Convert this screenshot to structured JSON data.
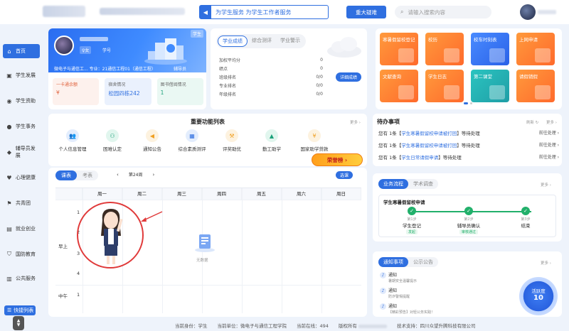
{
  "header": {
    "slogan": "为学生服务 为学生工作者服务",
    "major_button": "重大疑难",
    "search_placeholder": "请输入搜索内容"
  },
  "sidebar": {
    "items": [
      {
        "label": "首页",
        "icon": "home-icon"
      },
      {
        "label": "学生发展",
        "icon": "bag-icon"
      },
      {
        "label": "学生资助",
        "icon": "coin-icon"
      },
      {
        "label": "学生事务",
        "icon": "person-icon"
      },
      {
        "label": "辅导员发展",
        "icon": "graduate-icon"
      },
      {
        "label": "心理健康",
        "icon": "heart-icon"
      },
      {
        "label": "共青团",
        "icon": "flag-icon"
      },
      {
        "label": "就业创业",
        "icon": "briefcase-icon"
      },
      {
        "label": "国防教育",
        "icon": "shield-icon"
      },
      {
        "label": "公共服务",
        "icon": "building-icon"
      }
    ],
    "bottom_label": "快捷列表"
  },
  "profile": {
    "tag": "学生",
    "sex": "♀女",
    "sno_label": "学号",
    "info": "微电子与通信工...  专业：21通信工程01（通信工程）",
    "counselor": "辅导员",
    "mini": [
      {
        "title": "一卡通余额",
        "value": "¥"
      },
      {
        "title": "宿舍情况",
        "value": "松园四栋242"
      },
      {
        "title": "图书借阅情况",
        "value": "1"
      }
    ]
  },
  "grades": {
    "tabs": [
      "学业成绩",
      "综合测评",
      "学业警示"
    ],
    "rows": [
      {
        "label": "加权平均分",
        "value": "0"
      },
      {
        "label": "绩点",
        "value": "0"
      },
      {
        "label": "班级排名",
        "value": "0/0"
      },
      {
        "label": "专业排名",
        "value": "0/0"
      },
      {
        "label": "年级排名",
        "value": "0/0"
      }
    ],
    "detail_button": "详细成绩"
  },
  "quick_tiles": [
    {
      "label": "寒暑假留校登记",
      "color": "orange"
    },
    {
      "label": "校历",
      "color": "orange"
    },
    {
      "label": "校车时刻表",
      "color": "blue"
    },
    {
      "label": "上网申请",
      "color": "orange"
    },
    {
      "label": "文献查询",
      "color": "orange"
    },
    {
      "label": "学生日志",
      "color": "orange"
    },
    {
      "label": "第二课堂",
      "color": "teal"
    },
    {
      "label": "请假销假",
      "color": "orange"
    }
  ],
  "functions": {
    "title": "重要功能列表",
    "more": "更多 ›",
    "items": [
      {
        "label": "个人信息管理",
        "icon": "users-icon",
        "color": "#2f6fe0",
        "bg": "#e3edfd"
      },
      {
        "label": "困难认定",
        "icon": "people-icon",
        "color": "#1aa17a",
        "bg": "#e1f6ee"
      },
      {
        "label": "通知公告",
        "icon": "megaphone-icon",
        "color": "#f0a023",
        "bg": "#fdf2df"
      },
      {
        "label": "综合素质测评",
        "icon": "excel-icon",
        "color": "#2f6fe0",
        "bg": "#e3edfd"
      },
      {
        "label": "评奖助优",
        "icon": "gavel-icon",
        "color": "#f0a023",
        "bg": "#fdf2df"
      },
      {
        "label": "勤工助学",
        "icon": "cap-icon",
        "color": "#1aa17a",
        "bg": "#e1f6ee"
      },
      {
        "label": "国家助学贷款",
        "icon": "money-icon",
        "color": "#f0a023",
        "bg": "#fdf2df"
      }
    ],
    "promo": "荣誉榜 ›"
  },
  "todo": {
    "title": "待办事项",
    "refresh": "刷新 ↻",
    "more": "更多 ›",
    "items": [
      {
        "pre": "您有 1条【",
        "hl": "学生寒暑假留校申请被打回",
        "post": "】等待处理",
        "action": "前往处理 ›"
      },
      {
        "pre": "您有 1条【",
        "hl": "学生寒暑假留校申请被打回",
        "post": "】等待处理",
        "action": "前往处理 ›"
      },
      {
        "pre": "您有 1条【",
        "hl": "学生日常请假申请",
        "post": "】等待处理",
        "action": "前往处理 ›"
      }
    ]
  },
  "timetable": {
    "tabs": [
      "课表",
      "考表"
    ],
    "week": "第24周",
    "select_button": "选课",
    "days": [
      "周一",
      "周二",
      "周三",
      "周四",
      "周五",
      "周六",
      "周日"
    ],
    "sections": {
      "morning": "早上",
      "noon": "中午"
    },
    "periods": [
      "1",
      "2",
      "3",
      "4",
      "1"
    ],
    "empty": "无数据"
  },
  "flow": {
    "tabs": [
      "业务流程",
      "学术调查"
    ],
    "more": "更多 ›",
    "name": "学生寒暑假留校申请",
    "steps": [
      {
        "order": "第1步",
        "name": "学生登记",
        "status": "发起"
      },
      {
        "order": "第2步",
        "name": "辅导员确认",
        "status": "审核通过"
      },
      {
        "order": "第3步",
        "name": "结束",
        "status": ""
      }
    ]
  },
  "notices": {
    "tabs": [
      "通知事项",
      "公示公告"
    ],
    "more": "更多 ›",
    "items": [
      {
        "title": "通知",
        "sub": "暑期安全温馨提示"
      },
      {
        "title": "通知",
        "sub": "防诈警惕提醒"
      },
      {
        "title": "通知",
        "sub": "【精彩预告】对轻公务实践！"
      }
    ]
  },
  "online": {
    "label": "活跃度",
    "value": "10"
  },
  "footer": {
    "identity": "当前身份：学生",
    "unit": "当前单位：微电子与通信工程学院",
    "online": "当前在线：494",
    "copyright": "版权所有",
    "support": "技术支持：四川众望升腾科技有限公司"
  }
}
